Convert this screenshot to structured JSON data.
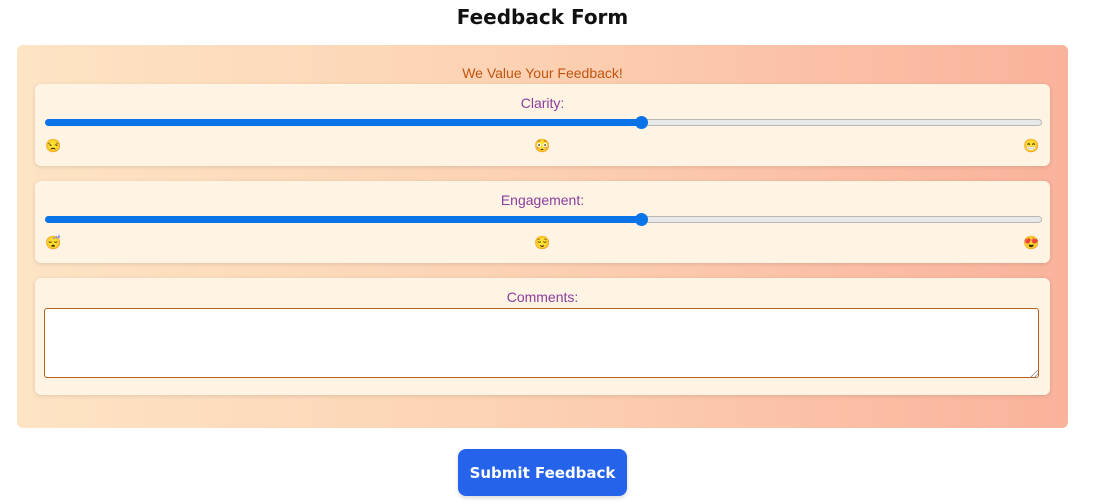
{
  "page": {
    "title": "Feedback Form"
  },
  "form": {
    "subtitle": "We Value Your Feedback!",
    "clarity": {
      "label": "Clarity:",
      "value": 0.6,
      "emoji_left": "😒",
      "emoji_mid": "😳",
      "emoji_right": "😁"
    },
    "engagement": {
      "label": "Engagement:",
      "value": 0.6,
      "emoji_left": "😴",
      "emoji_mid": "😌",
      "emoji_right": "😍"
    },
    "comments": {
      "label": "Comments:",
      "value": "",
      "placeholder": ""
    },
    "submit_label": "Submit Feedback"
  },
  "colors": {
    "accent": "#0a73e8",
    "button": "#2563eb",
    "label": "#8a3e9c",
    "subtitle": "#c0550f"
  }
}
